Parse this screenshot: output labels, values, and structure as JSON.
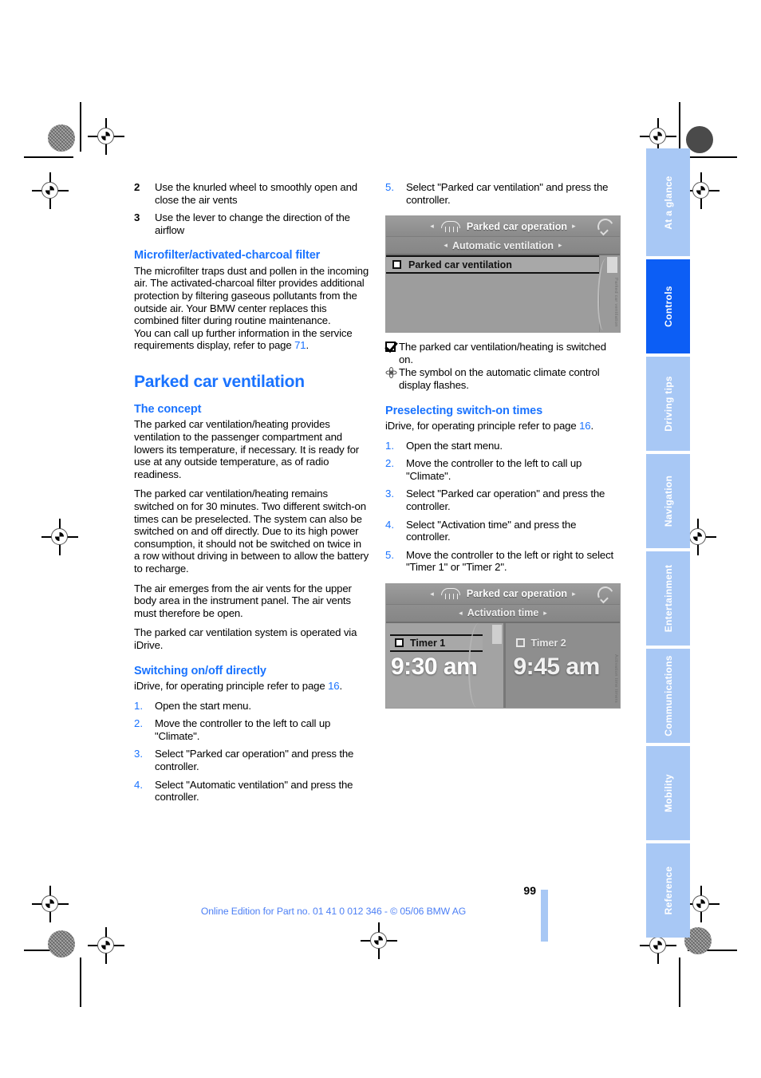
{
  "document": {
    "page_number": "99",
    "footer_note": "Online Edition for Part no. 01 41 0 012 346 - © 05/06 BMW AG"
  },
  "left_column": {
    "intro_steps": [
      {
        "num": "2",
        "text": "Use the knurled wheel to smoothly open and close the air vents"
      },
      {
        "num": "3",
        "text": "Use the lever to change the direction of the airflow"
      }
    ],
    "microfilter": {
      "heading": "Microfilter/activated-charcoal filter",
      "paragraph1": "The microfilter traps dust and pollen in the incoming air. The activated-charcoal filter provides additional protection by filtering gaseous pollutants from the outside air. Your BMW center replaces this combined filter during routine maintenance.",
      "paragraph2_pre": "You can call up further information in the service requirements display, refer to page ",
      "paragraph2_ref": "71",
      "paragraph2_post": "."
    },
    "parked_car_ventilation": {
      "heading": "Parked car ventilation",
      "concept_heading": "The concept",
      "concept_p1": "The parked car ventilation/heating provides ventilation to the passenger compartment and lowers its temperature, if necessary. It is ready for use at any outside temperature, as of radio readiness.",
      "concept_p2": "The parked car ventilation/heating remains switched on for 30 minutes. Two different switch-on times can be preselected. The system can also be switched on and off directly. Due to its high power consumption, it should not be switched on twice in a row without driving in between to allow the battery to recharge.",
      "concept_p3": "The air emerges from the air vents for the upper body area in the instrument panel. The air vents must therefore be open.",
      "concept_p4": "The parked car ventilation system is operated via iDrive.",
      "switching_heading": "Switching on/off directly",
      "switching_intro_pre": "iDrive, for operating principle refer to page ",
      "switching_intro_ref": "16",
      "switching_intro_post": ".",
      "switching_steps": [
        {
          "num": "1.",
          "text": "Open the start menu."
        },
        {
          "num": "2.",
          "text": "Move the controller to the left to call up \"Climate\"."
        },
        {
          "num": "3.",
          "text": "Select \"Parked car operation\" and press the controller."
        },
        {
          "num": "4.",
          "text": "Select \"Automatic ventilation\" and press the controller."
        }
      ]
    }
  },
  "right_column": {
    "step5": {
      "num": "5.",
      "text": "Select \"Parked car ventilation\" and press the controller."
    },
    "idrive_screen_1": {
      "title_bar": "Parked car operation",
      "sub_bar": "Automatic ventilation",
      "menu_item": "Parked car ventilation",
      "left_arrow": "◂",
      "right_arrow": "▸",
      "caption": "Parked car ventilation"
    },
    "result_lines": [
      {
        "symbol": "checkbox-checked-icon",
        "text": "The parked car ventilation/heating is switched on."
      },
      {
        "symbol": "fan-icon",
        "text": "The symbol on the automatic climate control display flashes."
      }
    ],
    "preselecting": {
      "heading": "Preselecting switch-on times",
      "intro_pre": "iDrive, for operating principle refer to page ",
      "intro_ref": "16",
      "intro_post": ".",
      "steps": [
        {
          "num": "1.",
          "text": "Open the start menu."
        },
        {
          "num": "2.",
          "text": "Move the controller to the left to call up \"Climate\"."
        },
        {
          "num": "3.",
          "text": "Select \"Parked car operation\" and press the controller."
        },
        {
          "num": "4.",
          "text": "Select \"Activation time\" and press the controller."
        },
        {
          "num": "5.",
          "text": "Move the controller to the left or right to select \"Timer 1\" or \"Timer 2\"."
        }
      ]
    },
    "idrive_screen_2": {
      "title_bar": "Parked car operation",
      "sub_bar": "Activation time",
      "left_arrow": "◂",
      "right_arrow": "▸",
      "timer1_label": "Timer 1",
      "timer1_time": "9:30 am",
      "timer2_label": "Timer 2",
      "timer2_time": "9:45 am",
      "caption": "Activation time timers"
    }
  },
  "nav_tabs": [
    {
      "label": "At a glance",
      "active": false
    },
    {
      "label": "Controls",
      "active": true
    },
    {
      "label": "Driving tips",
      "active": false
    },
    {
      "label": "Navigation",
      "active": false
    },
    {
      "label": "Entertainment",
      "active": false
    },
    {
      "label": "Communications",
      "active": false
    },
    {
      "label": "Mobility",
      "active": false
    },
    {
      "label": "Reference",
      "active": false
    }
  ],
  "colors": {
    "accent_blue": "#1a73ff",
    "tab_inactive": "#a8c8f5",
    "tab_active": "#0c5ef5",
    "footer_blue": "#4c7ff5"
  }
}
